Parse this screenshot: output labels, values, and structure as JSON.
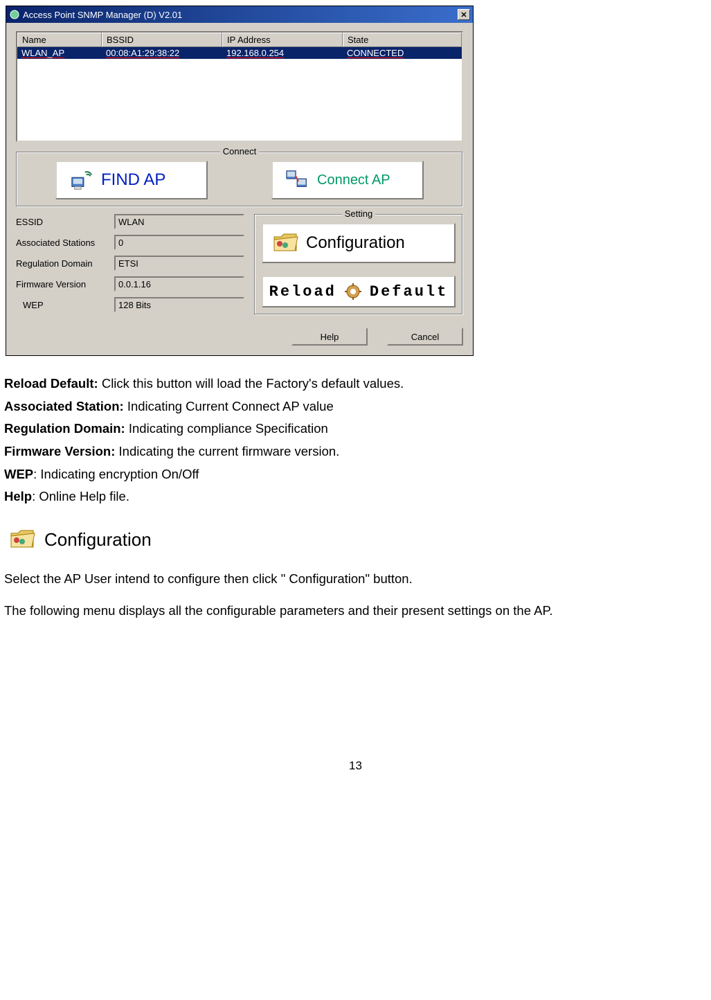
{
  "window": {
    "title": "Access Point SNMP Manager (D) V2.01",
    "columns": {
      "name": "Name",
      "bssid": "BSSID",
      "ip": "IP Address",
      "state": "State"
    },
    "row": {
      "name": "WLAN_AP",
      "bssid": "00:08:A1:29:38:22",
      "ip": "192.168.0.254",
      "state": "CONNECTED"
    },
    "connect_legend": "Connect",
    "find_ap": "FIND AP",
    "connect_ap": "Connect AP",
    "info": {
      "essid_label": "ESSID",
      "essid_value": "WLAN",
      "assoc_label": "Associated Stations",
      "assoc_value": "0",
      "reg_label": "Regulation Domain",
      "reg_value": "ETSI",
      "fw_label": "Firmware Version",
      "fw_value": "0.0.1.16",
      "wep_label": "WEP",
      "wep_value": "128 Bits"
    },
    "setting_legend": "Setting",
    "config_btn": "Configuration",
    "reload_a": "Reload",
    "reload_b": "Default",
    "help_btn": "Help",
    "cancel_btn": "Cancel"
  },
  "defs": {
    "reload_default_t": "Reload Default:",
    "reload_default_d": " Click this button will load the Factory's default values.",
    "assoc_t": "Associated Station:",
    "assoc_d": " Indicating Current Connect AP value",
    "reg_t": "Regulation Domain:",
    "reg_d": " Indicating compliance Specification",
    "fw_t": "Firmware Version:",
    "fw_d": " Indicating the current firmware version.",
    "wep_t": "WEP",
    "wep_d": ": Indicating encryption On/Off",
    "help_t": "Help",
    "help_d": ": Online Help file."
  },
  "config_heading": "Configuration",
  "para1": "Select the AP User intend to configure then click \" Configuration\" button.",
  "para2": "The following menu displays all the configurable parameters and their present settings on the AP.",
  "page_num": "13"
}
